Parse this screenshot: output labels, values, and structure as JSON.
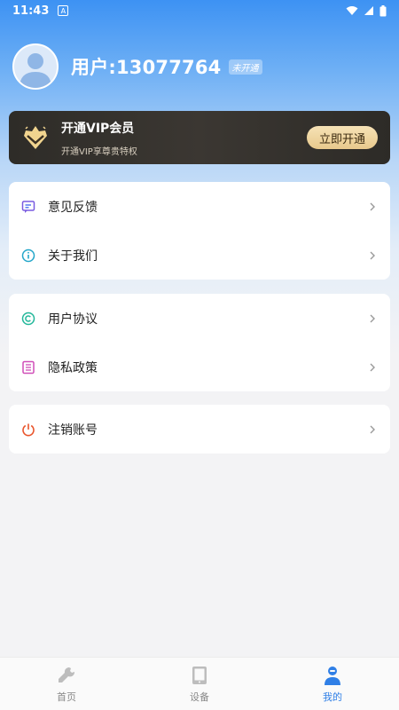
{
  "status_bar": {
    "time": "11:43",
    "notif_glyph": "A"
  },
  "profile": {
    "username": "用户:13077764",
    "vip_status": "未开通"
  },
  "vip_card": {
    "title": "开通VIP会员",
    "subtitle": "开通VIP享尊贵特权",
    "button": "立即开通"
  },
  "menu_groups": [
    [
      {
        "label": "意见反馈",
        "icon": "feedback-icon"
      },
      {
        "label": "关于我们",
        "icon": "info-icon"
      }
    ],
    [
      {
        "label": "用户协议",
        "icon": "copyright-icon"
      },
      {
        "label": "隐私政策",
        "icon": "list-icon"
      }
    ],
    [
      {
        "label": "注销账号",
        "icon": "power-icon"
      }
    ]
  ],
  "bottom_nav": [
    {
      "label": "首页",
      "icon": "wrench-icon",
      "active": false
    },
    {
      "label": "设备",
      "icon": "tablet-icon",
      "active": false
    },
    {
      "label": "我的",
      "icon": "user-icon",
      "active": true
    }
  ],
  "colors": {
    "accent": "#2f7fe6",
    "vip_gold": "#e8c98c",
    "header_blue": "#3d92f3"
  }
}
